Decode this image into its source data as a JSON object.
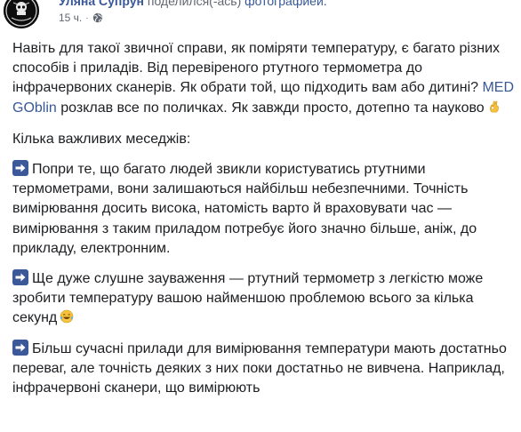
{
  "post": {
    "author": {
      "name": "Уляна Супрун",
      "action_text": "поделился(-ась)",
      "action_link": "фотографией."
    },
    "timestamp": "15 ч.",
    "dot": "·",
    "icons": {
      "avatar": "avatar-logo",
      "privacy": "globe-icon",
      "bullet": "right-arrow-icon",
      "emoji_ok": "ok-hand-emoji",
      "emoji_laugh": "tears-of-joy-emoji"
    },
    "colors": {
      "link": "#385898",
      "text": "#1c1e21",
      "meta": "#616770",
      "arrow_bg": "#3b5998"
    },
    "paragraphs": {
      "p1_a": "Навіть для такої звичної справи, як поміряти температуру, є багато різних способів і приладів. Від перевіреного ртутного термометра до інфрачервоних сканерів. Як обрати той, що підходить вам або дитині? ",
      "p1_link": "MED GOblin",
      "p1_b": " розклав все по поличках. Як завжди просто, дотепно та науково",
      "p2": "Кілька важливих меседжів:",
      "p3": "Попри те, що багато людей звикли користуватись ртутними термометрами, вони залишаються найбільш небезпечними. Точність вимірювання досить висока, натомість варто й враховувати час — вимірювання з таким приладом потребує його значно більше, аніж, до прикладу, електронним.",
      "p4": "Ще дуже слушне зауваження — ртутний термометр з легкістю може зробити температуру вашою найменшою проблемою всього за кілька секунд",
      "p5": "Більш сучасні прилади для вимірювання температури мають достатньо переваг, але точність деяких з них поки достатньо не вивчена. Наприклад, інфрачервоні сканери, що вимірюють"
    }
  }
}
